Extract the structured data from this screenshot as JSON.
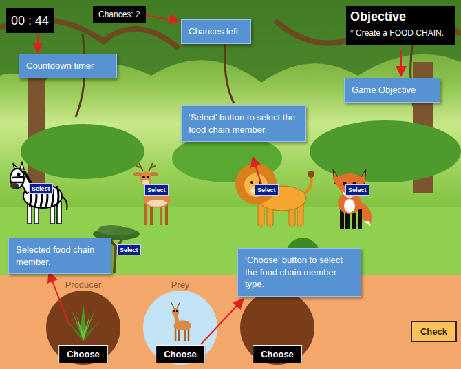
{
  "hud": {
    "timer": "00 : 44",
    "chances": "Chances: 2"
  },
  "objective": {
    "title": "Objective",
    "text": "* Create a FOOD CHAIN."
  },
  "members": [
    {
      "kind": "zebra",
      "button": "Select"
    },
    {
      "kind": "deer",
      "button": "Select"
    },
    {
      "kind": "lion",
      "button": "Select"
    },
    {
      "kind": "fox",
      "button": "Select"
    },
    {
      "kind": "tree",
      "button": "Select"
    }
  ],
  "slots": [
    {
      "label": "Producer",
      "button": "Choose",
      "filled": true,
      "kind": "bush",
      "selected": false
    },
    {
      "label": "Prey",
      "button": "Choose",
      "filled": true,
      "kind": "deer",
      "selected": true
    },
    {
      "label": "",
      "button": "Choose",
      "filled": false,
      "kind": "empty",
      "selected": false
    }
  ],
  "check": "Check",
  "callouts": [
    "Countdown timer",
    "Chances left",
    "Game Objective",
    "‘Select’ button to select the food chain member.",
    "Selected food chain member.",
    "‘Choose’ button to select the food chain member type."
  ]
}
